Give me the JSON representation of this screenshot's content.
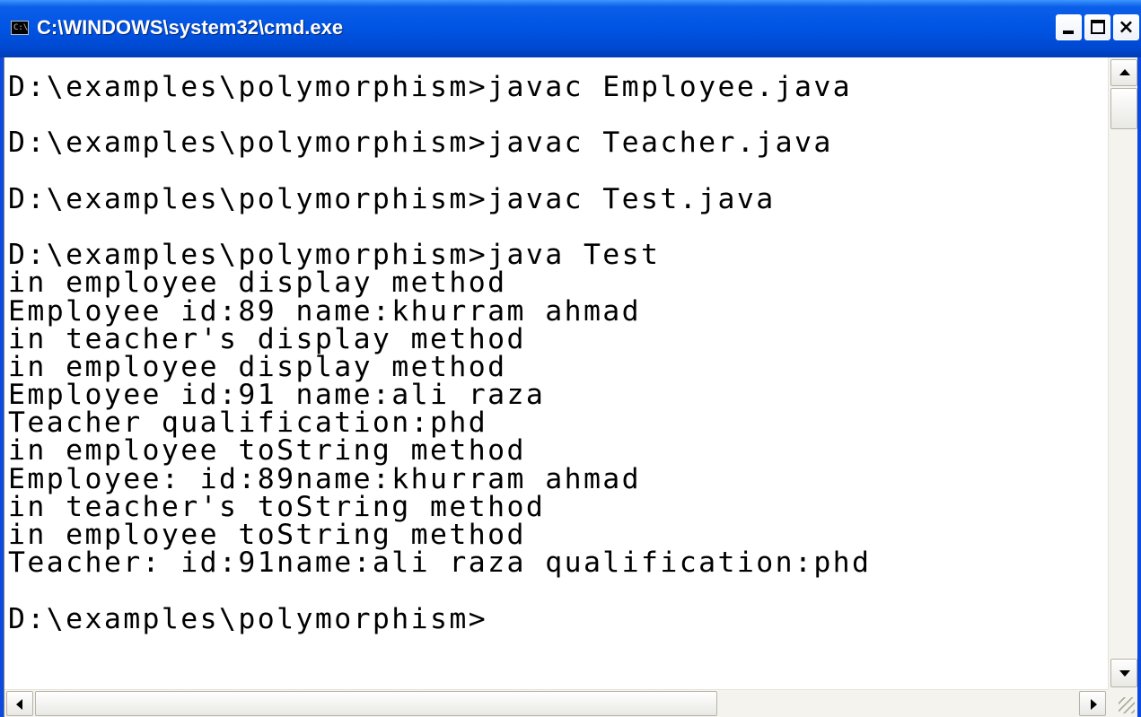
{
  "window": {
    "title": "C:\\WINDOWS\\system32\\cmd.exe",
    "icon_text": "C:\\",
    "controls": {
      "minimize": "minimize",
      "maximize": "maximize",
      "close": "×"
    }
  },
  "console": {
    "lines": [
      "D:\\examples\\polymorphism>javac Employee.java",
      "",
      "D:\\examples\\polymorphism>javac Teacher.java",
      "",
      "D:\\examples\\polymorphism>javac Test.java",
      "",
      "D:\\examples\\polymorphism>java Test",
      "in employee display method",
      "Employee id:89 name:khurram ahmad",
      "in teacher's display method",
      "in employee display method",
      "Employee id:91 name:ali raza",
      "Teacher qualification:phd",
      "in employee toString method",
      "Employee: id:89name:khurram ahmad",
      "in teacher's toString method",
      "in employee toString method",
      "Teacher: id:91name:ali raza qualification:phd",
      "",
      "D:\\examples\\polymorphism>"
    ]
  },
  "colors": {
    "titlebar": "#0054e3",
    "console_background": "#ffffff",
    "console_text": "#000000",
    "scrollbar_track": "#f4f3ee"
  },
  "icons": {
    "app": "console-icon",
    "minimize": "minimize-icon",
    "maximize": "maximize-icon",
    "close": "close-icon",
    "scroll_up": "arrow-up-icon",
    "scroll_down": "arrow-down-icon",
    "scroll_left": "arrow-left-icon",
    "scroll_right": "arrow-right-icon"
  }
}
